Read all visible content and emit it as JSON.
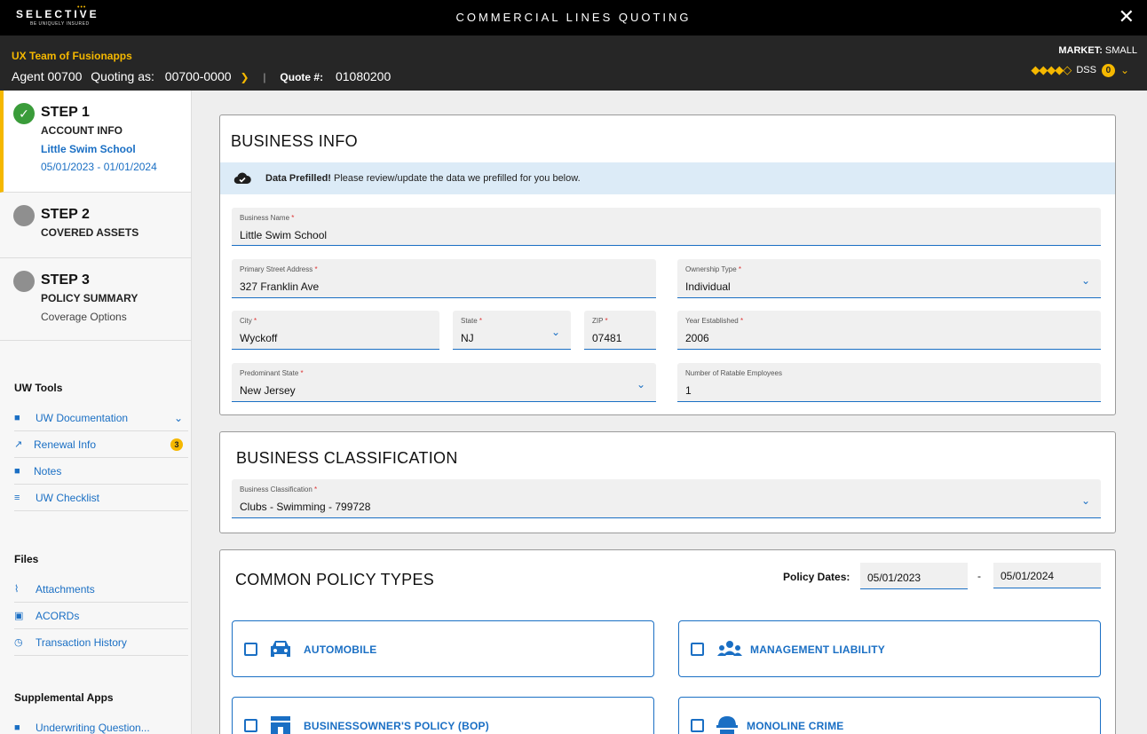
{
  "header": {
    "logo_text": "SELECTIVE",
    "logo_tagline": "BE UNIQUELY INSURED",
    "app_title": "COMMERCIAL LINES QUOTING",
    "close_icon": "close-icon"
  },
  "agent_bar": {
    "team": "UX Team of Fusionapps",
    "agent": "Agent 00700",
    "quoting_as_label": "Quoting as:",
    "quoting_as_value": "00700-0000",
    "quote_label": "Quote #:",
    "quote_number": "01080200",
    "market_label": "MARKET:",
    "market_value": "SMALL",
    "rating_diamonds": "◆◆◆◆◇",
    "dss_label": "DSS",
    "dss_count": "0",
    "accent_color": "#f5b800"
  },
  "steps": [
    {
      "title": "STEP 1",
      "subtitle": "ACCOUNT INFO",
      "link": "Little Swim School",
      "dates": "05/01/2023 - 01/01/2024",
      "status": "complete"
    },
    {
      "title": "STEP 2",
      "subtitle": "COVERED ASSETS",
      "status": "pending"
    },
    {
      "title": "STEP 3",
      "subtitle": "POLICY SUMMARY",
      "option": "Coverage Options",
      "status": "pending"
    }
  ],
  "uw_tools": {
    "heading": "UW Tools",
    "items": [
      {
        "label": "UW Documentation",
        "icon": "document-icon"
      },
      {
        "label": "Renewal Info",
        "icon": "renewal-icon",
        "count": "3"
      },
      {
        "label": "Notes",
        "icon": "notes-icon"
      },
      {
        "label": "UW Checklist",
        "icon": "checklist-icon"
      }
    ]
  },
  "files": {
    "heading": "Files",
    "items": [
      {
        "label": "Attachments",
        "icon": "paperclip-icon"
      },
      {
        "label": "ACORDs",
        "icon": "acord-icon"
      },
      {
        "label": "Transaction History",
        "icon": "history-icon"
      }
    ]
  },
  "supplemental": {
    "heading": "Supplemental Apps",
    "items": [
      {
        "label": "Underwriting Question...",
        "icon": "file-icon"
      }
    ]
  },
  "business_info": {
    "title": "BUSINESS INFO",
    "banner_bold": "Data Prefilled!",
    "banner_text": " Please review/update the data we prefilled for you below.",
    "fields": {
      "business_name": {
        "label": "Business Name",
        "value": "Little Swim School"
      },
      "street": {
        "label": "Primary Street Address",
        "value": "327 Franklin Ave"
      },
      "ownership": {
        "label": "Ownership Type",
        "value": "Individual"
      },
      "city": {
        "label": "City",
        "value": "Wyckoff"
      },
      "state": {
        "label": "State",
        "value": "NJ"
      },
      "zip": {
        "label": "ZIP",
        "value": "07481"
      },
      "year": {
        "label": "Year Established",
        "value": "2006"
      },
      "pred_state": {
        "label": "Predominant State",
        "value": "New Jersey"
      },
      "employees": {
        "label": "Number of Ratable Employees",
        "value": "1"
      }
    }
  },
  "business_classification": {
    "title": "BUSINESS CLASSIFICATION",
    "field": {
      "label": "Business Classification",
      "value": "Clubs - Swimming - 799728"
    }
  },
  "policy_types": {
    "title": "COMMON POLICY TYPES",
    "dates_label": "Policy Dates:",
    "date_start": "05/01/2023",
    "date_separator": "-",
    "date_end": "05/01/2024",
    "items": [
      {
        "label": "AUTOMOBILE",
        "icon": "car-icon"
      },
      {
        "label": "MANAGEMENT LIABILITY",
        "icon": "people-icon"
      },
      {
        "label": "BUSINESSOWNER'S POLICY (BOP)",
        "icon": "store-icon"
      },
      {
        "label": "MONOLINE CRIME",
        "icon": "burglar-icon"
      }
    ]
  }
}
